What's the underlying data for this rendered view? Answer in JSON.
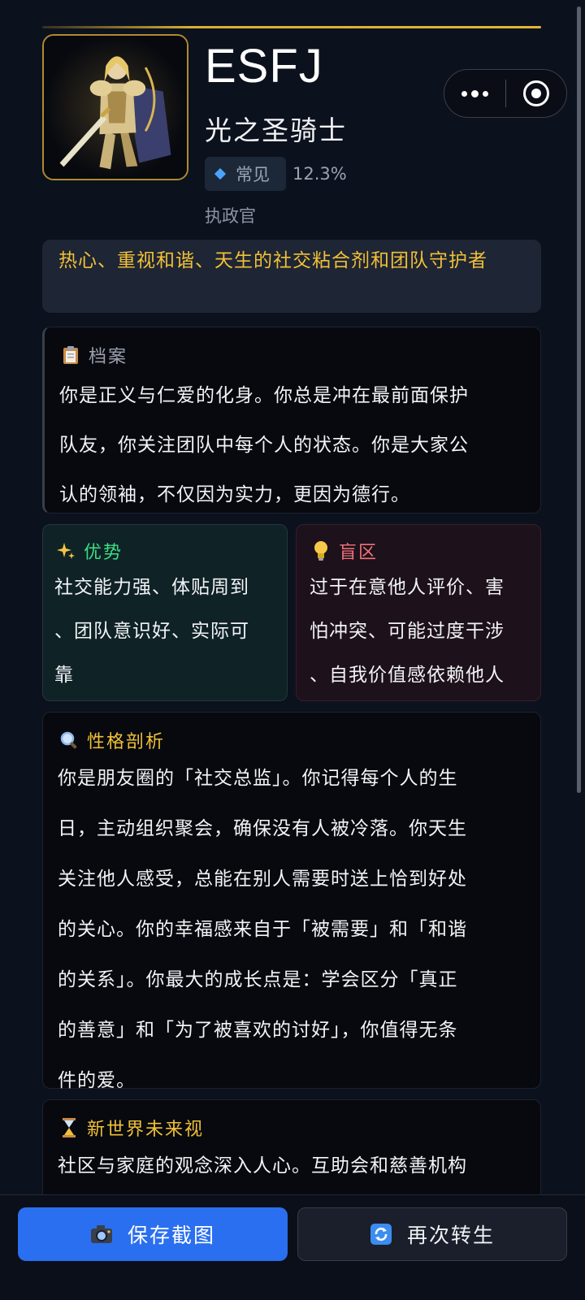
{
  "header": {
    "code": "ESFJ",
    "name": "光之圣骑士",
    "rarity_label": "常见",
    "rarity_pct": "12.3%",
    "role": "执政官"
  },
  "tagline": "热心、重视和谐、天生的社交粘合剂和团队守护者",
  "profile": {
    "title": "档案",
    "lines": [
      "你是正义与仁爱的化身。你总是冲在最前面保护",
      "队友，你关注团队中每个人的状态。你是大家公",
      "认的领袖，不仅因为实力，更因为德行。"
    ]
  },
  "strengths": {
    "title": "优势",
    "lines": [
      "社交能力强、体贴周到",
      "、团队意识好、实际可",
      "靠"
    ]
  },
  "blindspots": {
    "title": "盲区",
    "lines": [
      "过于在意他人评价、害",
      "怕冲突、可能过度干涉",
      "、自我价值感依赖他人"
    ]
  },
  "analysis": {
    "title": "性格剖析",
    "lines": [
      "你是朋友圈的「社交总监」。你记得每个人的生",
      "日，主动组织聚会，确保没有人被冷落。你天生",
      "关注他人感受，总能在别人需要时送上恰到好处",
      "的关心。你的幸福感来自于「被需要」和「和谐",
      "的关系」。你最大的成长点是：学会区分「真正",
      "的善意」和「为了被喜欢的讨好」，你值得无条",
      "件的爱。"
    ]
  },
  "future": {
    "title": "新世界未来视",
    "lines": [
      "社区与家庭的观念深入人心。互助会和慈善机构"
    ]
  },
  "actions": {
    "save_label": "保存截图",
    "again_label": "再次转生"
  },
  "icons": {
    "profile": "clipboard-icon",
    "strengths": "sparkles-icon",
    "blindspots": "lightbulb-icon",
    "analysis": "magnifier-icon",
    "future": "hourglass-icon",
    "save": "camera-icon",
    "again": "refresh-icon",
    "more": "more-dots-icon",
    "close": "close-ring-icon"
  },
  "colors": {
    "accent_gold": "#f0c037",
    "strength_green": "#3ddc84",
    "blind_red": "#f2727a",
    "primary_blue": "#2a6ff0"
  }
}
